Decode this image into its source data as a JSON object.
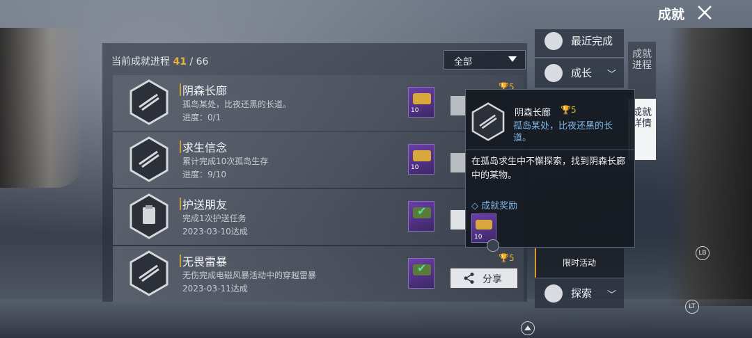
{
  "header": {
    "title": "成就"
  },
  "progress": {
    "label": "当前成就进程",
    "done": "41",
    "sep": " / ",
    "total": "66"
  },
  "filter": {
    "selected": "全部"
  },
  "achievements": [
    {
      "title": "阴森长廊",
      "desc": "孤岛某处，比夜还黑的长道。",
      "progress": "进度：0/1",
      "reward_qty": "10",
      "status": "in-progress"
    },
    {
      "title": "求生信念",
      "desc": "累计完成10次孤岛生存",
      "progress": "进度：9/10",
      "reward_qty": "10",
      "status": "in-progress"
    },
    {
      "title": "护送朋友",
      "desc": "完成1次护送任务",
      "progress": "2023-03-10达成",
      "reward_qty": "",
      "status": "done"
    },
    {
      "title": "无畏雷暴",
      "desc": "无伤完成电磁风暴活动中的穿越雷暴",
      "progress": "2023-03-11达成",
      "reward_qty": "",
      "status": "done",
      "points": "5",
      "share_label": "分享"
    }
  ],
  "first_row_points": "5",
  "categories": [
    {
      "label": "最近完成"
    },
    {
      "label": "成长"
    },
    {
      "label": "限时活动"
    },
    {
      "label": "探索"
    }
  ],
  "tabs": [
    {
      "label": "成就进程"
    },
    {
      "label": "成就详情"
    }
  ],
  "tooltip": {
    "title": "阴森长廊",
    "points": "5",
    "subtitle": "孤岛某处，比夜还黑的长道。",
    "body": "在孤岛求生中不懈探索，找到阴森长廊中的某物。",
    "reward_label": "◇ 成就奖励",
    "reward_qty": "10"
  },
  "controller_hints": {
    "lb": "LB",
    "lt": "LT"
  },
  "colors": {
    "accent_gold": "#e2b23c",
    "link_blue": "#7fb7e8",
    "reward_purple": "#6c3ea8"
  }
}
